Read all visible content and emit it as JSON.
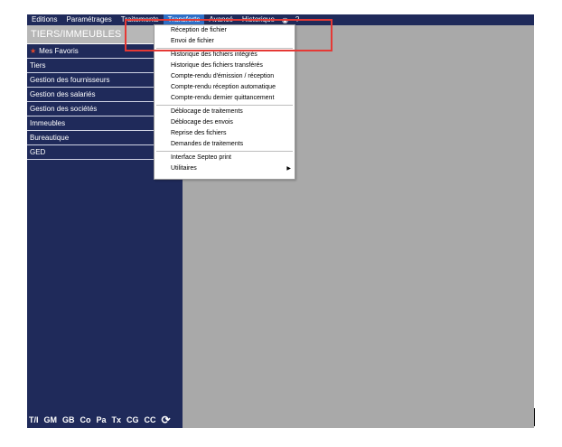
{
  "menubar": {
    "items": [
      {
        "label": "Editions"
      },
      {
        "label": "Paramétrages"
      },
      {
        "label": "Traitements"
      },
      {
        "label": "Transferts"
      },
      {
        "label": "Avancé"
      },
      {
        "label": "Historique"
      }
    ],
    "help_label": "?"
  },
  "sidebar": {
    "title": "TIERS/IMMEUBLES",
    "items": [
      {
        "label": "Mes Favoris"
      },
      {
        "label": "Tiers"
      },
      {
        "label": "Gestion des fournisseurs"
      },
      {
        "label": "Gestion des salariés"
      },
      {
        "label": "Gestion des sociétés"
      },
      {
        "label": "Immeubles"
      },
      {
        "label": "Bureautique"
      },
      {
        "label": "GED"
      }
    ],
    "bottom_buttons": [
      "T/I",
      "GM",
      "GB",
      "Co",
      "Pa",
      "Tx",
      "CG",
      "CC"
    ]
  },
  "dropdown": {
    "group1": [
      "Réception de fichier",
      "Envoi de fichier"
    ],
    "group2": [
      "Historique des fichiers intégrés",
      "Historique des fichiers transférés",
      "Compte-rendu d'émission / réception",
      "Compte-rendu réception automatique",
      "Compte-rendu dernier quittancement"
    ],
    "group3": [
      "Déblocage de traitements",
      "Déblocage des envois",
      "Reprise des fichiers",
      "Demandes de traitements"
    ],
    "group4": [
      "Interface Septeo print",
      "Utilitaires"
    ]
  }
}
